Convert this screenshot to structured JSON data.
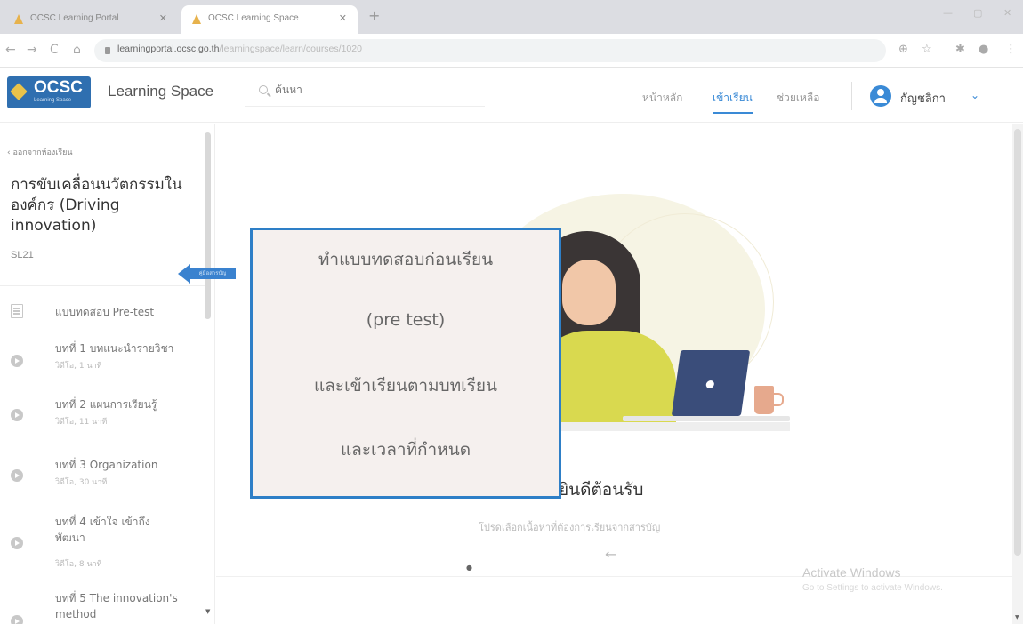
{
  "browser": {
    "tabs": [
      {
        "label": "OCSC Learning Portal",
        "active": false
      },
      {
        "label": "OCSC Learning Space",
        "active": true
      }
    ],
    "url_host": "learningportal.ocsc.go.th",
    "url_path": "/learningspace/learn/courses/1020",
    "new_tab_icon": "+",
    "back_icon": "←",
    "forward_icon": "→",
    "reload_icon": "C",
    "home_icon": "⌂",
    "window_controls": [
      "—",
      "▢",
      "✕"
    ],
    "right_icons": [
      "⊕",
      "☆",
      "✱",
      "⋮"
    ]
  },
  "header": {
    "logo_text": "OCSC",
    "logo_subtext": "Learning Space",
    "app_title": "Learning Space",
    "search_placeholder": "ค้นหา",
    "nav": [
      {
        "label": "หน้าหลัก",
        "active": false
      },
      {
        "label": "เข้าเรียน",
        "active": true
      },
      {
        "label": "ช่วยเหลือ",
        "active": false
      }
    ],
    "user_name": "กัญชลิกา",
    "chevron": "⌄",
    "accent_color": "#3a8ad6"
  },
  "sidebar": {
    "back_label": "ออกจากห้องเรียน",
    "back_icon": "‹",
    "course_title": "การขับเคลื่อนนวัตกรรมในองค์กร (Driving innovation)",
    "course_code": "SL21",
    "lessons": [
      {
        "icon": "document-icon",
        "title": "แบบทดสอบ Pre-test",
        "meta": ""
      },
      {
        "icon": "play-icon",
        "title": "บทที่ 1 บทแนะนำรายวิชา",
        "meta": "วิดีโอ, 1 นาที"
      },
      {
        "icon": "play-icon",
        "title": "บทที่ 2 แผนการเรียนรู้",
        "meta": "วิดีโอ, 11 นาที"
      },
      {
        "icon": "play-icon",
        "title": "บทที่ 3 Organization",
        "meta": "วิดีโอ, 30 นาที"
      },
      {
        "icon": "play-icon",
        "title": "บทที่ 4 เข้าใจ เข้าถึง พัฒนา",
        "meta": "วิดีโอ, 8 นาที"
      },
      {
        "icon": "play-icon",
        "title": "บทที่ 5 The innovation's method",
        "meta": ""
      }
    ]
  },
  "main": {
    "welcome_title": "ยินดีต้อนรับ",
    "welcome_subtitle": "โปรดเลือกเนื้อหาที่ต้องการเรียนจากสารบัญ",
    "back_arrow": "←",
    "watermark_title": "Activate Windows",
    "watermark_subtitle": "Go to Settings to activate Windows."
  },
  "callout": {
    "lines": [
      "ทำแบบทดสอบก่อนเรียน",
      "(pre test)",
      "และเข้าเรียนตามบทเรียน",
      "และเวลาที่กำหนด"
    ],
    "arrow_label": "คู่มือสารบัญ",
    "border_color": "#2e7fc7"
  }
}
